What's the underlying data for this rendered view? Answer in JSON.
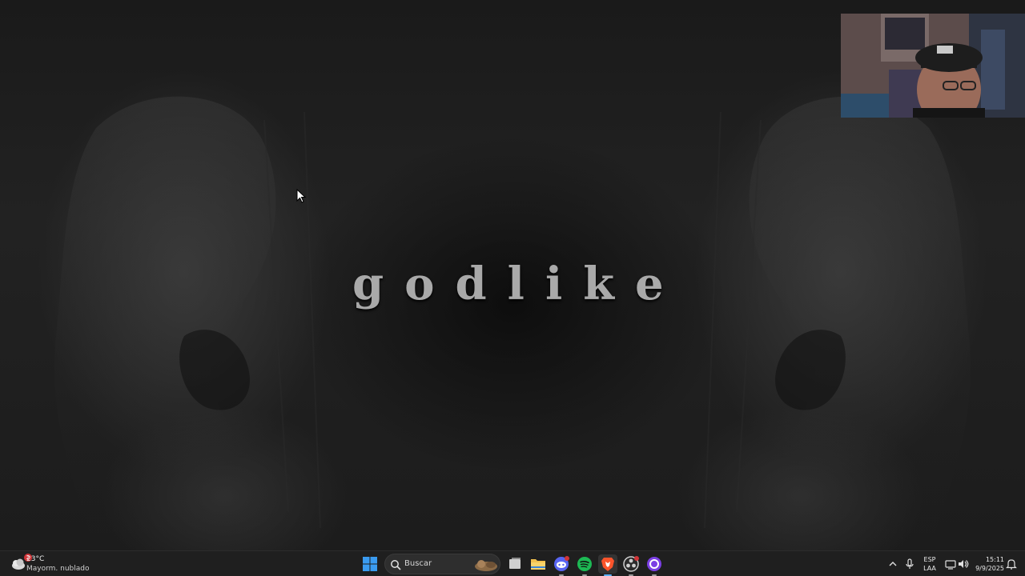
{
  "desktop": {
    "wallpaper_title": "godlike"
  },
  "taskbar": {
    "weather": {
      "badge": "2",
      "temperature": "23°C",
      "description": "Mayorm. nublado"
    },
    "search": {
      "label": "Buscar"
    },
    "apps": [
      {
        "name": "Start",
        "icon": "windows-icon"
      },
      {
        "name": "Task View",
        "icon": "task-view-icon"
      },
      {
        "name": "File Explorer",
        "icon": "folder-icon"
      },
      {
        "name": "Discord",
        "icon": "discord-icon"
      },
      {
        "name": "Spotify",
        "icon": "spotify-icon"
      },
      {
        "name": "Brave",
        "icon": "brave-icon"
      },
      {
        "name": "OBS Studio",
        "icon": "obs-icon"
      },
      {
        "name": "App",
        "icon": "purple-ring-icon"
      }
    ],
    "tray": {
      "language_top": "ESP",
      "language_bottom": "LAA",
      "time": "15:11",
      "date": "9/9/2025"
    }
  },
  "colors": {
    "taskbar_bg": "#1f1f1f",
    "wallpaper_text": "#a9a9a9",
    "windows_blue": "#3a9bf0",
    "spotify_green": "#1db954",
    "brave_orange": "#fb542b",
    "discord_blurple": "#5865f2",
    "badge_red": "#d13438"
  }
}
